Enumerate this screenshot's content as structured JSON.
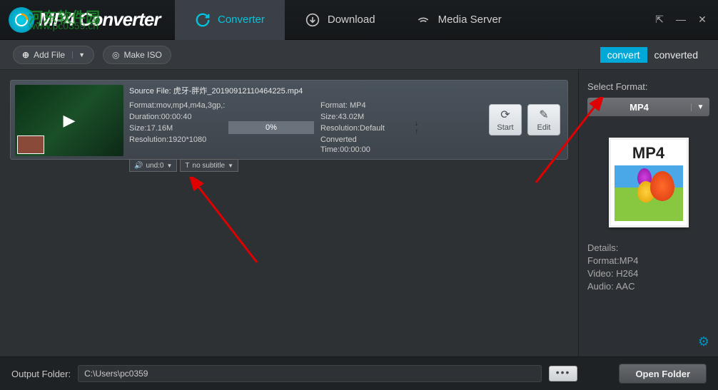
{
  "header": {
    "app_name": "MP4 Converter",
    "watermark_line1": "河东软件园",
    "watermark_line2": "www.pc0359.cn",
    "tabs": [
      {
        "label": "Converter",
        "icon": "refresh-icon"
      },
      {
        "label": "Download",
        "icon": "download-icon"
      },
      {
        "label": "Media Server",
        "icon": "wifi-icon"
      }
    ]
  },
  "toolbar": {
    "add_file_label": "Add File",
    "make_iso_label": "Make ISO",
    "subtab_convert": "convert",
    "subtab_converted": "converted"
  },
  "file": {
    "source_label": "Source File:",
    "source_name": "虎牙-胖炸_20190912110464225.mp4",
    "src_format_label": "Format:",
    "src_format": "mov,mp4,m4a,3gp,:",
    "duration_label": "Duration:",
    "duration": "00:00:40",
    "size_label": "Size:",
    "size": "17.16M",
    "res_label": "Resolution:",
    "res": "1920*1080",
    "progress": "0%",
    "out_format_label": "Format:",
    "out_format": "MP4",
    "out_size_label": "Size:",
    "out_size": "43.02M",
    "out_res_label": "Resolution:",
    "out_res": "Default",
    "conv_time_label": "Converted Time:",
    "conv_time": "00:00:00",
    "audio_track": "und:0",
    "subtitle": "no subtitle",
    "start_label": "Start",
    "edit_label": "Edit"
  },
  "sidebar": {
    "select_format_label": "Select Format:",
    "format_value": "MP4",
    "card_label": "MP4",
    "details_header": "Details:",
    "detail_format": "Format:MP4",
    "detail_video": "Video: H264",
    "detail_audio": "Audio: AAC"
  },
  "footer": {
    "output_label": "Output Folder:",
    "output_path": "C:\\Users\\pc0359",
    "browse": "•••",
    "open_folder": "Open Folder"
  }
}
